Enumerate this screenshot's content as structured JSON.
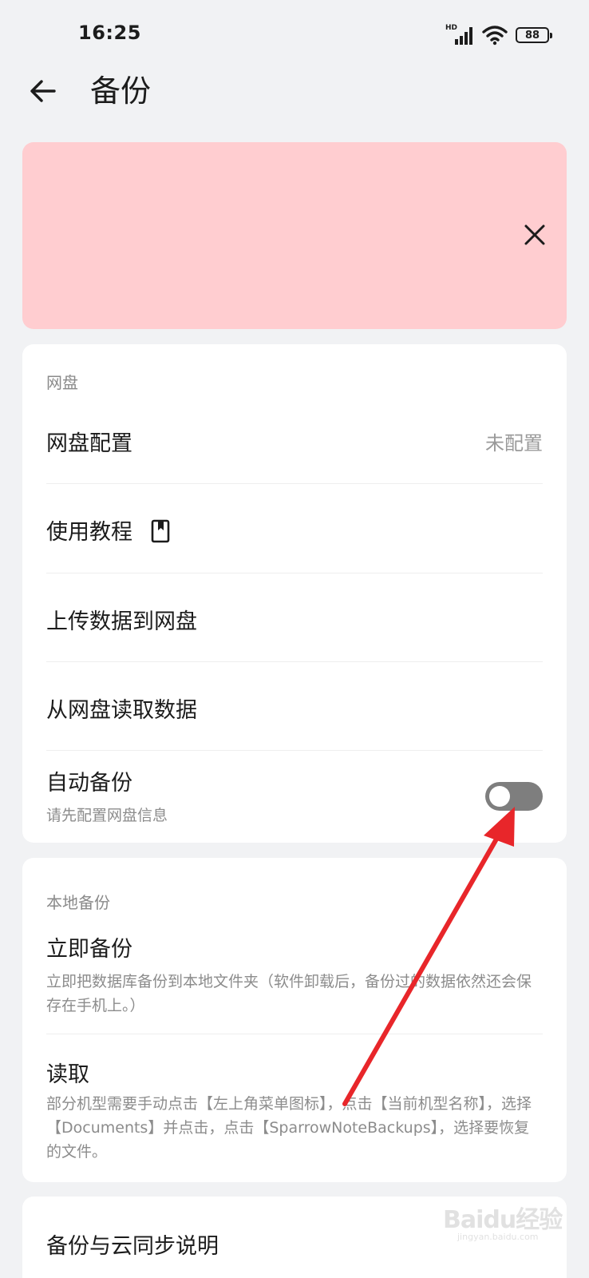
{
  "status_bar": {
    "time": "16:25",
    "hd_label": "HD",
    "battery_level": "88",
    "icons": [
      "signal-icon",
      "wifi-icon",
      "battery-icon"
    ]
  },
  "header": {
    "title": "备份",
    "back_icon": "arrow-left-icon"
  },
  "banner": {
    "background_color": "#ffcdd0",
    "close_icon": "close-icon"
  },
  "cloud_section": {
    "header": "网盘",
    "items": [
      {
        "label": "网盘配置",
        "value": "未配置"
      },
      {
        "label": "使用教程",
        "icon": "book-icon"
      },
      {
        "label": "上传数据到网盘"
      },
      {
        "label": "从网盘读取数据"
      },
      {
        "label": "自动备份",
        "subtitle": "请先配置网盘信息",
        "toggle_on": false
      }
    ]
  },
  "local_section": {
    "header": "本地备份",
    "items": [
      {
        "label": "立即备份",
        "subtitle": "立即把数据库备份到本地文件夹（软件卸载后，备份过的数据依然还会保存在手机上。）"
      },
      {
        "label": "读取",
        "subtitle": "部分机型需要手动点击【左上角菜单图标】，点击【当前机型名称】，选择【Documents】并点击，点击【SparrowNoteBackups】，选择要恢复的文件。"
      }
    ]
  },
  "info_section": {
    "items": [
      {
        "label": "备份与云同步说明"
      }
    ]
  },
  "watermark": {
    "text": "Baidu经验",
    "url": "jingyan.baidu.com"
  },
  "colors": {
    "background": "#f1f2f4",
    "card": "#ffffff",
    "banner": "#ffcdd0",
    "annotation_arrow": "#e8262a",
    "toggle_off": "#7e7e7e"
  }
}
